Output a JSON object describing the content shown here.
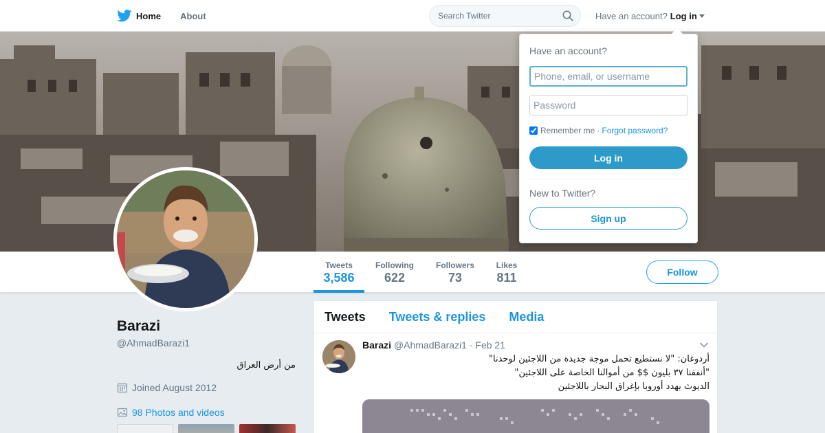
{
  "nav": {
    "home_label": "Home",
    "about_label": "About",
    "search_placeholder": "Search Twitter",
    "account_prompt": "Have an account?",
    "login_label": "Log in"
  },
  "profile_nav": {
    "stats": [
      {
        "label": "Tweets",
        "value": "3,586",
        "active": true
      },
      {
        "label": "Following",
        "value": "622",
        "active": false
      },
      {
        "label": "Followers",
        "value": "73",
        "active": false
      },
      {
        "label": "Likes",
        "value": "811",
        "active": false
      }
    ],
    "follow_label": "Follow"
  },
  "profile": {
    "name": "Barazi",
    "handle": "@AhmadBarazi1",
    "bio": "من أرض العراق",
    "joined": "Joined August 2012",
    "photos_link": "98 Photos and videos"
  },
  "timeline": {
    "tabs": [
      "Tweets",
      "Tweets & replies",
      "Media"
    ],
    "tweet": {
      "name": "Barazi",
      "handle": "@AhmadBarazi1",
      "date": "· Feb 21",
      "lines": [
        "أردوغان: \"لا نستطيع تحمل موجة جديدة من اللاجئين لوحدنا\"",
        "\"أنفقنا ٣٧ بليون $$ من أموالنا الخاصة على اللاجئين\"",
        "الديوث يهدد أوروبا بإغراق البحار باللاجئين"
      ]
    }
  },
  "login_dropdown": {
    "title": "Have an account?",
    "username_placeholder": "Phone, email, or username",
    "password_placeholder": "Password",
    "remember_label": "Remember me",
    "separator": "·",
    "forgot_label": "Forgot password?",
    "login_button": "Log in",
    "new_prompt": "New to Twitter?",
    "signup_button": "Sign up"
  },
  "colors": {
    "brand": "#1da1f2",
    "link": "#1b95e0",
    "login_button": "#2d9bc9"
  }
}
